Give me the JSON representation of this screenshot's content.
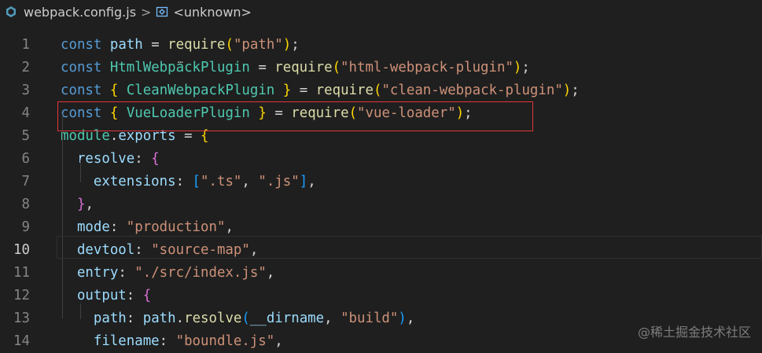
{
  "breadcrumb": {
    "file_icon": "js-file-icon",
    "file": "webpack.config.js",
    "separator": ">",
    "symbol_icon": "symbol-variable-icon",
    "symbol": "<unknown>"
  },
  "editor": {
    "active_line": 10,
    "lines": [
      {
        "num": "1",
        "tokens": [
          [
            "kw",
            "const"
          ],
          [
            "pl",
            " "
          ],
          [
            "var",
            "path"
          ],
          [
            "op",
            " = "
          ],
          [
            "fn",
            "require"
          ],
          [
            "b1",
            "("
          ],
          [
            "str",
            "\"path\""
          ],
          [
            "b1",
            ")"
          ],
          [
            "pl",
            ";"
          ]
        ]
      },
      {
        "num": "2",
        "tokens": [
          [
            "kw",
            "const"
          ],
          [
            "pl",
            " "
          ],
          [
            "cls",
            "HtmlWebpackPlugin"
          ],
          [
            "op",
            " = "
          ],
          [
            "fn",
            "require"
          ],
          [
            "b1",
            "("
          ],
          [
            "str",
            "\"html-webpack-plugin\""
          ],
          [
            "b1",
            ")"
          ],
          [
            "pl",
            ";"
          ]
        ]
      },
      {
        "num": "3",
        "tokens": [
          [
            "kw",
            "const"
          ],
          [
            "pl",
            " "
          ],
          [
            "b1",
            "{"
          ],
          [
            "pl",
            " "
          ],
          [
            "cls",
            "CleanWebpackPlugin"
          ],
          [
            "pl",
            " "
          ],
          [
            "b1",
            "}"
          ],
          [
            "op",
            " = "
          ],
          [
            "fn",
            "require"
          ],
          [
            "b1",
            "("
          ],
          [
            "str",
            "\"clean-webpack-plugin\""
          ],
          [
            "b1",
            ")"
          ],
          [
            "pl",
            ";"
          ]
        ]
      },
      {
        "num": "4",
        "tokens": [
          [
            "kw",
            "const"
          ],
          [
            "pl",
            " "
          ],
          [
            "b1",
            "{"
          ],
          [
            "pl",
            " "
          ],
          [
            "cls",
            "VueLoaderPlugin"
          ],
          [
            "pl",
            " "
          ],
          [
            "b1",
            "}"
          ],
          [
            "op",
            " = "
          ],
          [
            "fn",
            "require"
          ],
          [
            "b1",
            "("
          ],
          [
            "str",
            "\"vue-loader\""
          ],
          [
            "b1",
            ")"
          ],
          [
            "pl",
            ";"
          ]
        ]
      },
      {
        "num": "5",
        "tokens": [
          [
            "cls",
            "module"
          ],
          [
            "pl",
            "."
          ],
          [
            "var",
            "exports"
          ],
          [
            "op",
            " = "
          ],
          [
            "b1",
            "{"
          ]
        ]
      },
      {
        "num": "6",
        "tokens": [
          [
            "pl",
            "  "
          ],
          [
            "var",
            "resolve"
          ],
          [
            "pl",
            ": "
          ],
          [
            "b2",
            "{"
          ]
        ]
      },
      {
        "num": "7",
        "tokens": [
          [
            "pl",
            "    "
          ],
          [
            "var",
            "extensions"
          ],
          [
            "pl",
            ": "
          ],
          [
            "b3",
            "["
          ],
          [
            "str",
            "\".ts\""
          ],
          [
            "pl",
            ", "
          ],
          [
            "str",
            "\".js\""
          ],
          [
            "b3",
            "]"
          ],
          [
            "pl",
            ","
          ]
        ]
      },
      {
        "num": "8",
        "tokens": [
          [
            "pl",
            "  "
          ],
          [
            "b2",
            "}"
          ],
          [
            "pl",
            ","
          ]
        ]
      },
      {
        "num": "9",
        "tokens": [
          [
            "pl",
            "  "
          ],
          [
            "var",
            "mode"
          ],
          [
            "pl",
            ": "
          ],
          [
            "str",
            "\"production\""
          ],
          [
            "pl",
            ","
          ]
        ]
      },
      {
        "num": "10",
        "tokens": [
          [
            "pl",
            "  "
          ],
          [
            "var",
            "devtool"
          ],
          [
            "pl",
            ": "
          ],
          [
            "str",
            "\"source-map\""
          ],
          [
            "pl",
            ","
          ]
        ]
      },
      {
        "num": "11",
        "tokens": [
          [
            "pl",
            "  "
          ],
          [
            "var",
            "entry"
          ],
          [
            "pl",
            ": "
          ],
          [
            "str",
            "\"./src/index.js\""
          ],
          [
            "pl",
            ","
          ]
        ]
      },
      {
        "num": "12",
        "tokens": [
          [
            "pl",
            "  "
          ],
          [
            "var",
            "output"
          ],
          [
            "pl",
            ": "
          ],
          [
            "b2",
            "{"
          ]
        ]
      },
      {
        "num": "13",
        "tokens": [
          [
            "pl",
            "    "
          ],
          [
            "var",
            "path"
          ],
          [
            "pl",
            ": "
          ],
          [
            "var",
            "path"
          ],
          [
            "pl",
            "."
          ],
          [
            "fn",
            "resolve"
          ],
          [
            "b3",
            "("
          ],
          [
            "var",
            "__dirname"
          ],
          [
            "pl",
            ", "
          ],
          [
            "str",
            "\"build\""
          ],
          [
            "b3",
            ")"
          ],
          [
            "pl",
            ","
          ]
        ]
      },
      {
        "num": "14",
        "tokens": [
          [
            "pl",
            "    "
          ],
          [
            "var",
            "filename"
          ],
          [
            "pl",
            ": "
          ],
          [
            "str",
            "\"boundle.js\""
          ],
          [
            "pl",
            ","
          ]
        ]
      }
    ]
  },
  "watermark": "@稀土掘金技术社区"
}
